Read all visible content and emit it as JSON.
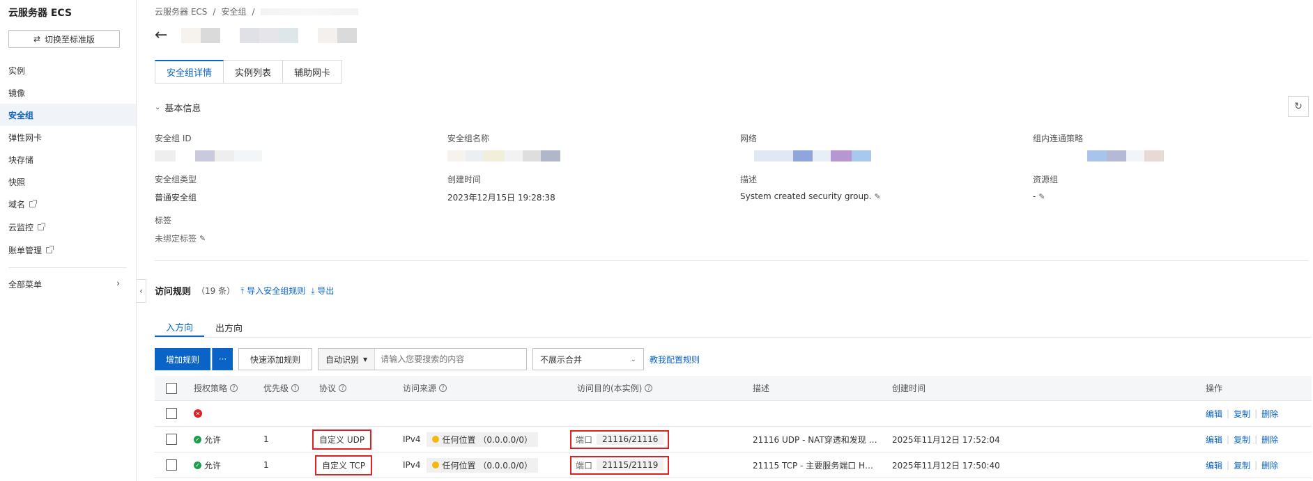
{
  "sidebar": {
    "title": "云服务器 ECS",
    "switch_label": "切换至标准版",
    "items": [
      {
        "label": "实例",
        "external": false
      },
      {
        "label": "镜像",
        "external": false
      },
      {
        "label": "安全组",
        "external": false,
        "active": true
      },
      {
        "label": "弹性网卡",
        "external": false
      },
      {
        "label": "块存储",
        "external": false
      },
      {
        "label": "快照",
        "external": false
      },
      {
        "label": "域名",
        "external": true
      },
      {
        "label": "云监控",
        "external": true
      },
      {
        "label": "账单管理",
        "external": true
      }
    ],
    "all_menu": "全部菜单"
  },
  "breadcrumb": [
    "云服务器 ECS",
    "/",
    "安全组",
    "/"
  ],
  "tabs": [
    "安全组详情",
    "实例列表",
    "辅助网卡"
  ],
  "basic_info": {
    "title": "基本信息",
    "fields": {
      "sg_id_label": "安全组 ID",
      "sg_name_label": "安全组名称",
      "network_label": "网络",
      "intra_policy_label": "组内连通策略",
      "sg_type_label": "安全组类型",
      "sg_type_value": "普通安全组",
      "created_label": "创建时间",
      "created_value": "2023年12月15日 19:28:38",
      "desc_label": "描述",
      "desc_value": "System created security group.",
      "resgroup_label": "资源组",
      "resgroup_value": "-",
      "tags_label": "标签",
      "tags_value": "未绑定标签"
    }
  },
  "rules": {
    "title": "访问规则",
    "count": "（19 条）",
    "import_link": "导入安全组规则",
    "export_link": "导出",
    "dir_tabs": [
      "入方向",
      "出方向"
    ],
    "toolbar": {
      "add_rule": "增加规则",
      "more": "···",
      "quick_add": "快速添加规则",
      "search_type": "自动识别",
      "search_placeholder": "请输入您要搜索的内容",
      "merge_select": "不展示合并",
      "teach_link": "教我配置规则"
    },
    "columns": [
      "授权策略",
      "优先级",
      "协议",
      "访问来源",
      "访问目的(本实例)",
      "描述",
      "创建时间",
      "操作"
    ],
    "rows": [
      {
        "policy": "",
        "priority": "",
        "protocol": "",
        "src_ver": "",
        "src": "",
        "port_label": "",
        "port": "",
        "desc": "",
        "created": "",
        "ops": [
          "编辑",
          "复制",
          "删除"
        ],
        "error": true
      },
      {
        "policy": "允许",
        "priority": "1",
        "protocol": "自定义 UDP",
        "src_ver": "IPv4",
        "src": "任何位置 （0.0.0.0/0）",
        "port_label": "端口",
        "port": "21116/21116",
        "desc": "21116 UDP - NAT穿透和发现 UD...",
        "created": "2025年11月12日 17:52:04",
        "ops": [
          "编辑",
          "复制",
          "删除"
        ],
        "error": false
      },
      {
        "policy": "允许",
        "priority": "1",
        "protocol": "自定义 TCP",
        "src_ver": "IPv4",
        "src": "任何位置 （0.0.0.0/0）",
        "port_label": "端口",
        "port": "21115/21119",
        "desc": "21115 TCP - 主要服务端口 HBBS ...",
        "created": "2025年11月12日 17:50:40",
        "ops": [
          "编辑",
          "复制",
          "删除"
        ],
        "error": false
      }
    ]
  },
  "colors": {
    "accent": "#0a64c8",
    "highlight": "#e02020",
    "success": "#1e9e4a"
  }
}
